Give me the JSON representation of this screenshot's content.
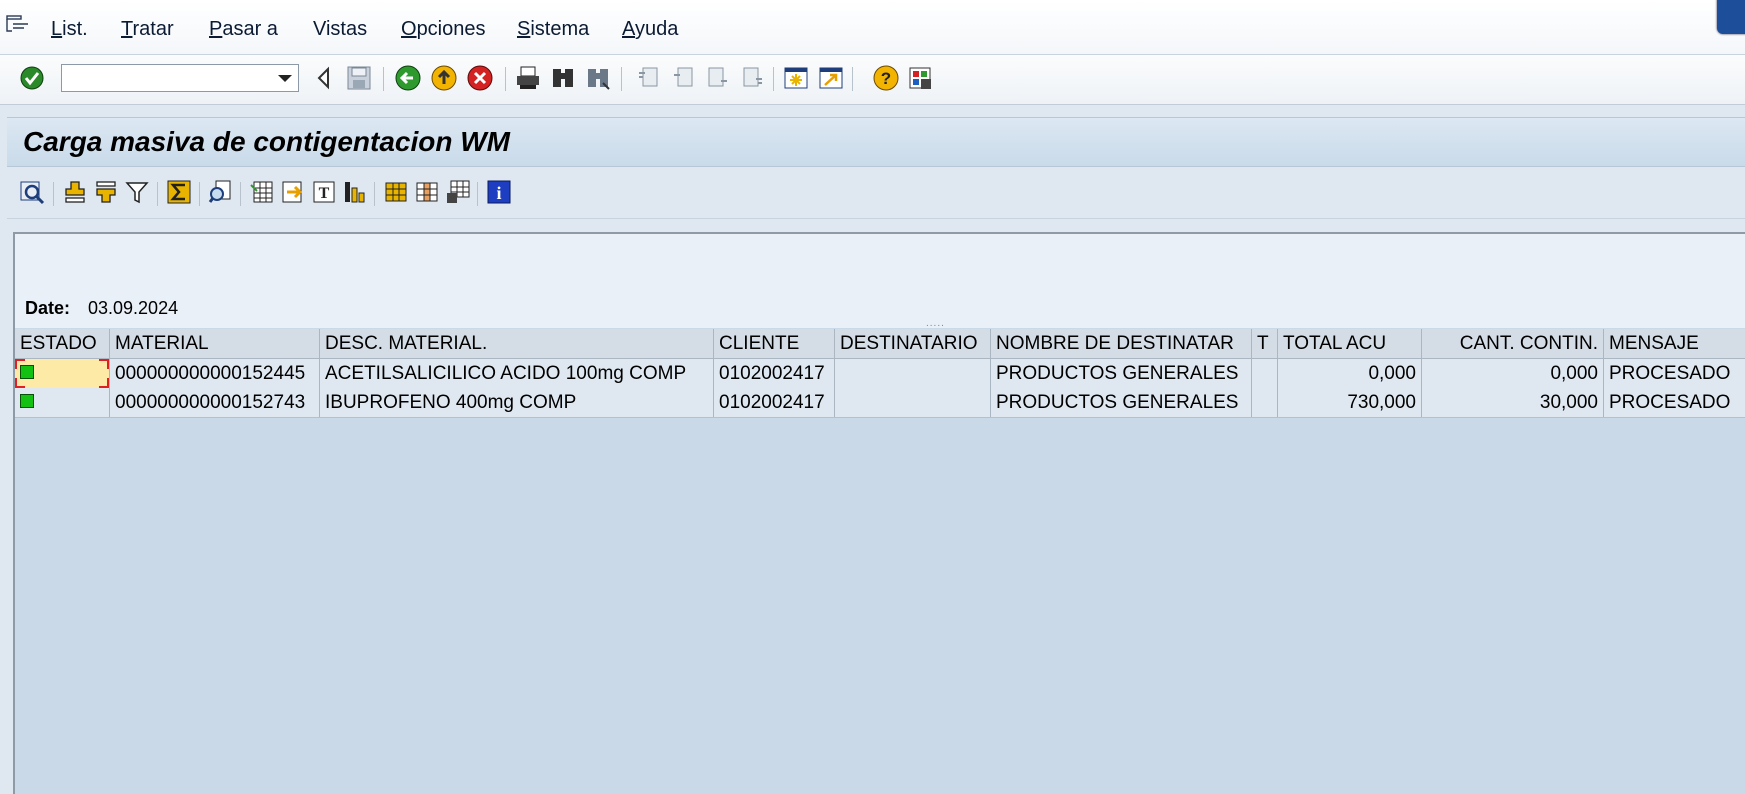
{
  "menu": {
    "items": [
      {
        "label": "List.",
        "ul": "L",
        "rest": "ist."
      },
      {
        "label": "Tratar",
        "ul": "T",
        "rest": "ratar"
      },
      {
        "label": "Pasar a",
        "ul": "P",
        "rest": "asar a"
      },
      {
        "label": "Vistas",
        "ul": "",
        "rest": "Vistas"
      },
      {
        "label": "Opciones",
        "ul": "O",
        "rest": "pciones"
      },
      {
        "label": "Sistema",
        "ul": "S",
        "rest": "istema"
      },
      {
        "label": "Ayuda",
        "ul": "A",
        "rest": "yuda"
      }
    ]
  },
  "toolbar": {
    "command_value": "",
    "icons": [
      "enter-icon",
      "back-arrow-icon",
      "save-icon",
      "back-icon",
      "exit-icon",
      "cancel-icon",
      "print-icon",
      "find-icon",
      "find-next-icon",
      "first-page-icon",
      "previous-page-icon",
      "next-page-icon",
      "last-page-icon",
      "create-session-icon",
      "shortcut-icon",
      "help-icon",
      "layout-icon"
    ]
  },
  "title": "Carga masiva de contigentacion WM",
  "alv_toolbar": {
    "icons": [
      "details-icon",
      "sort-ascending-icon",
      "sort-descending-icon",
      "filter-icon",
      "sum-icon",
      "print-preview-icon",
      "export-spreadsheet-icon",
      "export-file-icon",
      "word-processing-icon",
      "graphic-icon",
      "layout-select-icon",
      "layout-change-icon",
      "layout-save-icon",
      "info-icon"
    ]
  },
  "header": {
    "date_label": "Date:",
    "date_value": "03.09.2024"
  },
  "grid": {
    "columns": [
      "ESTADO",
      "MATERIAL",
      "DESC. MATERIAL.",
      "CLIENTE",
      "DESTINATARIO",
      "NOMBRE DE DESTINATAR",
      "T",
      "TOTAL ACU",
      "CANT. CONTIN.",
      "MENSAJE"
    ],
    "rows": [
      {
        "estado": "green",
        "material": "000000000000152445",
        "desc": "ACETILSALICILICO ACIDO 100mg COMP",
        "cliente": "0102002417",
        "destinatario": "",
        "nombre": "PRODUCTOS GENERALES",
        "t": "",
        "total": "0,000",
        "cant": "0,000",
        "mensaje": "PROCESADO"
      },
      {
        "estado": "green",
        "material": "000000000000152743",
        "desc": "IBUPROFENO 400mg COMP",
        "cliente": "0102002417",
        "destinatario": "",
        "nombre": "PRODUCTOS GENERALES",
        "t": "",
        "total": "730,000",
        "cant": "30,000",
        "mensaje": "PROCESADO"
      }
    ]
  },
  "colors": {
    "status_ok": "#13c113",
    "title_bg": "#c9dae9",
    "grid_bg": "#cad9e7"
  }
}
